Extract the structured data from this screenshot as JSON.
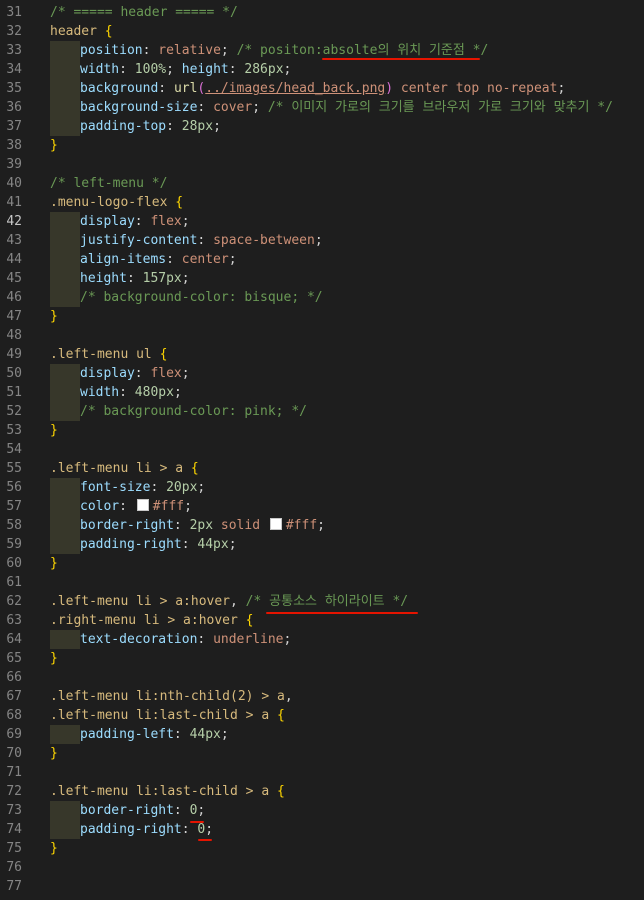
{
  "lines": [
    {
      "n": "31",
      "tokens": [
        {
          "t": "/* ===== header ===== */",
          "c": "c"
        }
      ]
    },
    {
      "n": "32",
      "tokens": [
        {
          "t": "header",
          "c": "sel"
        },
        {
          "t": " ",
          "c": "punc"
        },
        {
          "t": "{",
          "c": "brace"
        }
      ]
    },
    {
      "n": "33",
      "indent": 1,
      "tokens": [
        {
          "t": "position",
          "c": "prop"
        },
        {
          "t": ": ",
          "c": "punc"
        },
        {
          "t": "relative",
          "c": "val"
        },
        {
          "t": "; ",
          "c": "punc"
        },
        {
          "t": "/* positon:absolte의 위치 기준점 */",
          "c": "c"
        }
      ]
    },
    {
      "n": "34",
      "indent": 1,
      "tokens": [
        {
          "t": "width",
          "c": "prop"
        },
        {
          "t": ": ",
          "c": "punc"
        },
        {
          "t": "100%",
          "c": "num"
        },
        {
          "t": "; ",
          "c": "punc"
        },
        {
          "t": "height",
          "c": "prop"
        },
        {
          "t": ": ",
          "c": "punc"
        },
        {
          "t": "286px",
          "c": "num"
        },
        {
          "t": ";",
          "c": "punc"
        }
      ]
    },
    {
      "n": "35",
      "indent": 1,
      "tokens": [
        {
          "t": "background",
          "c": "prop"
        },
        {
          "t": ": ",
          "c": "punc"
        },
        {
          "t": "url",
          "c": "fn"
        },
        {
          "t": "(",
          "c": "paren"
        },
        {
          "t": "../images/head_back.png",
          "c": "url"
        },
        {
          "t": ")",
          "c": "paren"
        },
        {
          "t": " center top no-repeat",
          "c": "val"
        },
        {
          "t": ";",
          "c": "punc"
        }
      ]
    },
    {
      "n": "36",
      "indent": 1,
      "tokens": [
        {
          "t": "background-size",
          "c": "prop"
        },
        {
          "t": ": ",
          "c": "punc"
        },
        {
          "t": "cover",
          "c": "val"
        },
        {
          "t": "; ",
          "c": "punc"
        },
        {
          "t": "/* 이미지 가로의 크기를 브라우저 가로 크기와 맞추기 */",
          "c": "c"
        }
      ]
    },
    {
      "n": "37",
      "indent": 1,
      "tokens": [
        {
          "t": "padding-top",
          "c": "prop"
        },
        {
          "t": ": ",
          "c": "punc"
        },
        {
          "t": "28px",
          "c": "num"
        },
        {
          "t": ";",
          "c": "punc"
        }
      ]
    },
    {
      "n": "38",
      "tokens": [
        {
          "t": "}",
          "c": "brace"
        }
      ]
    },
    {
      "n": "39",
      "tokens": []
    },
    {
      "n": "40",
      "tokens": [
        {
          "t": "/* left-menu */",
          "c": "c"
        }
      ]
    },
    {
      "n": "41",
      "tokens": [
        {
          "t": ".menu-logo-flex",
          "c": "sel"
        },
        {
          "t": " ",
          "c": "punc"
        },
        {
          "t": "{",
          "c": "brace"
        }
      ]
    },
    {
      "n": "42",
      "indent": 1,
      "active": true,
      "tokens": [
        {
          "t": "display",
          "c": "prop"
        },
        {
          "t": ": ",
          "c": "punc"
        },
        {
          "t": "flex",
          "c": "val"
        },
        {
          "t": ";",
          "c": "punc"
        }
      ]
    },
    {
      "n": "43",
      "indent": 1,
      "tokens": [
        {
          "t": "justify-content",
          "c": "prop"
        },
        {
          "t": ": ",
          "c": "punc"
        },
        {
          "t": "space-between",
          "c": "val"
        },
        {
          "t": ";",
          "c": "punc"
        }
      ]
    },
    {
      "n": "44",
      "indent": 1,
      "tokens": [
        {
          "t": "align-items",
          "c": "prop"
        },
        {
          "t": ": ",
          "c": "punc"
        },
        {
          "t": "center",
          "c": "val"
        },
        {
          "t": ";",
          "c": "punc"
        }
      ]
    },
    {
      "n": "45",
      "indent": 1,
      "tokens": [
        {
          "t": "height",
          "c": "prop"
        },
        {
          "t": ": ",
          "c": "punc"
        },
        {
          "t": "157px",
          "c": "num"
        },
        {
          "t": ";",
          "c": "punc"
        }
      ]
    },
    {
      "n": "46",
      "indent": 1,
      "tokens": [
        {
          "t": "/* background-color: bisque; */",
          "c": "c"
        }
      ]
    },
    {
      "n": "47",
      "tokens": [
        {
          "t": "}",
          "c": "brace"
        }
      ]
    },
    {
      "n": "48",
      "tokens": []
    },
    {
      "n": "49",
      "tokens": [
        {
          "t": ".left-menu ul",
          "c": "sel"
        },
        {
          "t": " ",
          "c": "punc"
        },
        {
          "t": "{",
          "c": "brace"
        }
      ]
    },
    {
      "n": "50",
      "indent": 1,
      "tokens": [
        {
          "t": "display",
          "c": "prop"
        },
        {
          "t": ": ",
          "c": "punc"
        },
        {
          "t": "flex",
          "c": "val"
        },
        {
          "t": ";",
          "c": "punc"
        }
      ]
    },
    {
      "n": "51",
      "indent": 1,
      "tokens": [
        {
          "t": "width",
          "c": "prop"
        },
        {
          "t": ": ",
          "c": "punc"
        },
        {
          "t": "480px",
          "c": "num"
        },
        {
          "t": ";",
          "c": "punc"
        }
      ]
    },
    {
      "n": "52",
      "indent": 1,
      "tokens": [
        {
          "t": "/* background-color: pink; */",
          "c": "c"
        }
      ]
    },
    {
      "n": "53",
      "tokens": [
        {
          "t": "}",
          "c": "brace"
        }
      ]
    },
    {
      "n": "54",
      "tokens": []
    },
    {
      "n": "55",
      "tokens": [
        {
          "t": ".left-menu li > a",
          "c": "sel"
        },
        {
          "t": " ",
          "c": "punc"
        },
        {
          "t": "{",
          "c": "brace"
        }
      ]
    },
    {
      "n": "56",
      "indent": 1,
      "tokens": [
        {
          "t": "font-size",
          "c": "prop"
        },
        {
          "t": ": ",
          "c": "punc"
        },
        {
          "t": "20px",
          "c": "num"
        },
        {
          "t": ";",
          "c": "punc"
        }
      ]
    },
    {
      "n": "57",
      "indent": 1,
      "tokens": [
        {
          "t": "color",
          "c": "prop"
        },
        {
          "t": ": ",
          "c": "punc"
        },
        {
          "swatch": "#ffffff"
        },
        {
          "t": "#fff",
          "c": "val"
        },
        {
          "t": ";",
          "c": "punc"
        }
      ]
    },
    {
      "n": "58",
      "indent": 1,
      "tokens": [
        {
          "t": "border-right",
          "c": "prop"
        },
        {
          "t": ": ",
          "c": "punc"
        },
        {
          "t": "2px",
          "c": "num"
        },
        {
          "t": " solid ",
          "c": "val"
        },
        {
          "swatch": "#ffffff"
        },
        {
          "t": "#fff",
          "c": "val"
        },
        {
          "t": ";",
          "c": "punc"
        }
      ]
    },
    {
      "n": "59",
      "indent": 1,
      "tokens": [
        {
          "t": "padding-right",
          "c": "prop"
        },
        {
          "t": ": ",
          "c": "punc"
        },
        {
          "t": "44px",
          "c": "num"
        },
        {
          "t": ";",
          "c": "punc"
        }
      ]
    },
    {
      "n": "60",
      "tokens": [
        {
          "t": "}",
          "c": "brace"
        }
      ]
    },
    {
      "n": "61",
      "tokens": []
    },
    {
      "n": "62",
      "tokens": [
        {
          "t": ".left-menu li > a:hover",
          "c": "sel"
        },
        {
          "t": ", ",
          "c": "punc"
        },
        {
          "t": "/* 공통소스 하이라이트 */",
          "c": "c"
        }
      ]
    },
    {
      "n": "63",
      "tokens": [
        {
          "t": ".right-menu li > a:hover",
          "c": "sel"
        },
        {
          "t": " ",
          "c": "punc"
        },
        {
          "t": "{",
          "c": "brace"
        }
      ]
    },
    {
      "n": "64",
      "indent": 1,
      "tokens": [
        {
          "t": "text-decoration",
          "c": "prop"
        },
        {
          "t": ": ",
          "c": "punc"
        },
        {
          "t": "underline",
          "c": "val"
        },
        {
          "t": ";",
          "c": "punc"
        }
      ]
    },
    {
      "n": "65",
      "tokens": [
        {
          "t": "}",
          "c": "brace"
        }
      ]
    },
    {
      "n": "66",
      "tokens": []
    },
    {
      "n": "67",
      "tokens": [
        {
          "t": ".left-menu li:nth-child(2) > a",
          "c": "sel"
        },
        {
          "t": ",",
          "c": "punc"
        }
      ]
    },
    {
      "n": "68",
      "tokens": [
        {
          "t": ".left-menu li:last-child > a",
          "c": "sel"
        },
        {
          "t": " ",
          "c": "punc"
        },
        {
          "t": "{",
          "c": "brace"
        }
      ]
    },
    {
      "n": "69",
      "indent": 1,
      "tokens": [
        {
          "t": "padding-left",
          "c": "prop"
        },
        {
          "t": ": ",
          "c": "punc"
        },
        {
          "t": "44px",
          "c": "num"
        },
        {
          "t": ";",
          "c": "punc"
        }
      ]
    },
    {
      "n": "70",
      "tokens": [
        {
          "t": "}",
          "c": "brace"
        }
      ]
    },
    {
      "n": "71",
      "tokens": []
    },
    {
      "n": "72",
      "tokens": [
        {
          "t": ".left-menu li:last-child > a",
          "c": "sel"
        },
        {
          "t": " ",
          "c": "punc"
        },
        {
          "t": "{",
          "c": "brace"
        }
      ]
    },
    {
      "n": "73",
      "indent": 1,
      "tokens": [
        {
          "t": "border-right",
          "c": "prop"
        },
        {
          "t": ": ",
          "c": "punc"
        },
        {
          "t": "0",
          "c": "num"
        },
        {
          "t": ";",
          "c": "punc"
        }
      ]
    },
    {
      "n": "74",
      "indent": 1,
      "tokens": [
        {
          "t": "padding-right",
          "c": "prop"
        },
        {
          "t": ": ",
          "c": "punc"
        },
        {
          "t": "0",
          "c": "num"
        },
        {
          "t": ";",
          "c": "punc"
        }
      ]
    },
    {
      "n": "75",
      "tokens": [
        {
          "t": "}",
          "c": "brace"
        }
      ]
    },
    {
      "n": "76",
      "tokens": []
    },
    {
      "n": "77",
      "tokens": []
    }
  ],
  "colors": {
    "background": "#1e1e1e",
    "annotation": "#e51400"
  }
}
